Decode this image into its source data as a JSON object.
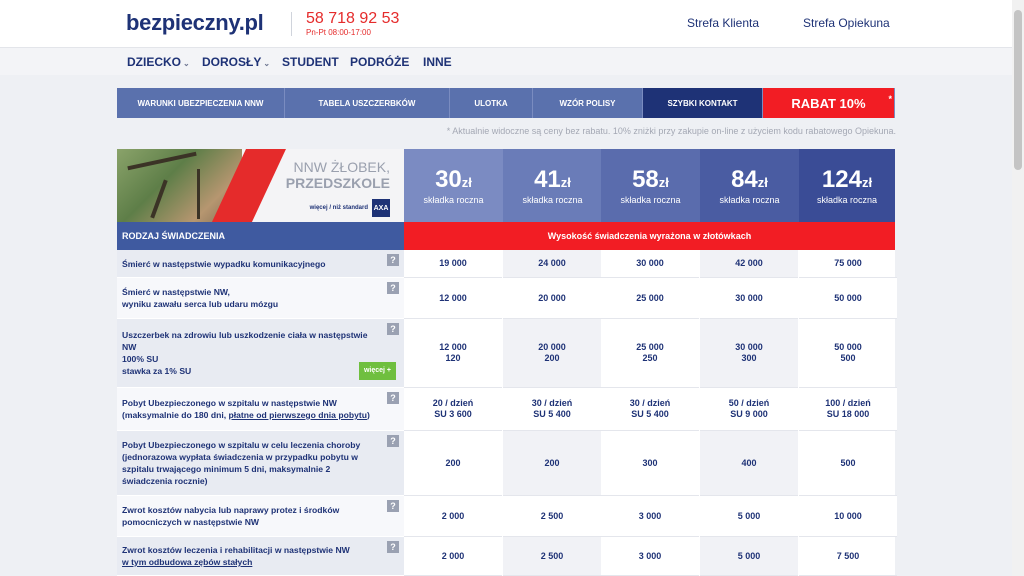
{
  "header": {
    "logo": "bezpieczny.pl",
    "phone": "58 718 92 53",
    "hours": "Pn-Pt 08:00-17:00",
    "links": [
      "Strefa Klienta",
      "Strefa Opiekuna"
    ]
  },
  "nav": [
    "DZIECKO",
    "DOROSŁY",
    "STUDENT",
    "PODRÓŻE",
    "INNE"
  ],
  "tabs": [
    "WARUNKI UBEZPIECZENIA NNW",
    "TABELA USZCZERBKÓW",
    "ULOTKA",
    "WZÓR POLISY",
    "SZYBKI KONTAKT",
    "RABAT 10%"
  ],
  "discount_note": "* Aktualnie widoczne są ceny bez rabatu. 10% zniżki przy zakupie on-line z użyciem kodu rabatowego Opiekuna.",
  "product": {
    "title_line1": "NNW ŻŁOBEK,",
    "title_line2": "PRZEDSZKOLE",
    "tagline": "więcej / niż standard",
    "insurer_logo": "AXA"
  },
  "prices": [
    {
      "amount": "30",
      "currency": "zł",
      "label": "składka roczna",
      "color": "#7b8bc2"
    },
    {
      "amount": "41",
      "currency": "zł",
      "label": "składka roczna",
      "color": "#6a7cb8"
    },
    {
      "amount": "58",
      "currency": "zł",
      "label": "składka roczna",
      "color": "#5a6cad"
    },
    {
      "amount": "84",
      "currency": "zł",
      "label": "składka roczna",
      "color": "#4a5ca2"
    },
    {
      "amount": "124",
      "currency": "zł",
      "label": "składka roczna",
      "color": "#3a4c96"
    }
  ],
  "section": {
    "left": "RODZAJ ŚWIADCZENIA",
    "right": "Wysokość świadczenia wyrażona w złotówkach"
  },
  "more_label": "więcej +",
  "help_icon": "?",
  "rows": [
    {
      "label": "Śmierć w następstwie wypadku komunikacyjnego",
      "values": [
        "19 000",
        "24 000",
        "30 000",
        "42 000",
        "75 000"
      ]
    },
    {
      "label": "Śmierć w następstwie NW,\nwyniku zawału serca lub udaru mózgu",
      "values": [
        "12 000",
        "20 000",
        "25 000",
        "30 000",
        "50 000"
      ]
    },
    {
      "label": "Uszczerbek na zdrowiu lub uszkodzenie ciała w następstwie NW\n100% SU\nstawka za 1% SU",
      "values": [
        "12 000\n120",
        "20 000\n200",
        "25 000\n250",
        "30 000\n300",
        "50 000\n500"
      ]
    },
    {
      "label_main": "Pobyt Ubezpieczonego w szpitalu w następstwie NW\n(maksymalnie do 180 dni, ",
      "label_underline": "płatne od pierwszego dnia pobytu",
      "label_tail": ")",
      "values": [
        "20 / dzień\nSU 3 600",
        "30 / dzień\nSU 5 400",
        "30 / dzień\nSU 5 400",
        "50 / dzień\nSU 9 000",
        "100 / dzień\nSU 18 000"
      ]
    },
    {
      "label": "Pobyt Ubezpieczonego w szpitalu w celu leczenia choroby\n(jednorazowa wypłata świadczenia w przypadku pobytu w szpitalu trwającego minimum 5 dni, maksymalnie 2 świadczenia rocznie)",
      "values": [
        "200",
        "200",
        "300",
        "400",
        "500"
      ]
    },
    {
      "label": "Zwrot kosztów nabycia lub naprawy protez i środków pomocniczych w następstwie NW",
      "values": [
        "2 000",
        "2 500",
        "3 000",
        "5 000",
        "10 000"
      ]
    },
    {
      "label_main": "Zwrot kosztów leczenia i rehabilitacji w następstwie NW\n",
      "label_underline": "w tym odbudowa zębów stałych",
      "label_tail": "",
      "values": [
        "2 000",
        "2 500",
        "3 000",
        "5 000",
        "7 500"
      ]
    }
  ]
}
